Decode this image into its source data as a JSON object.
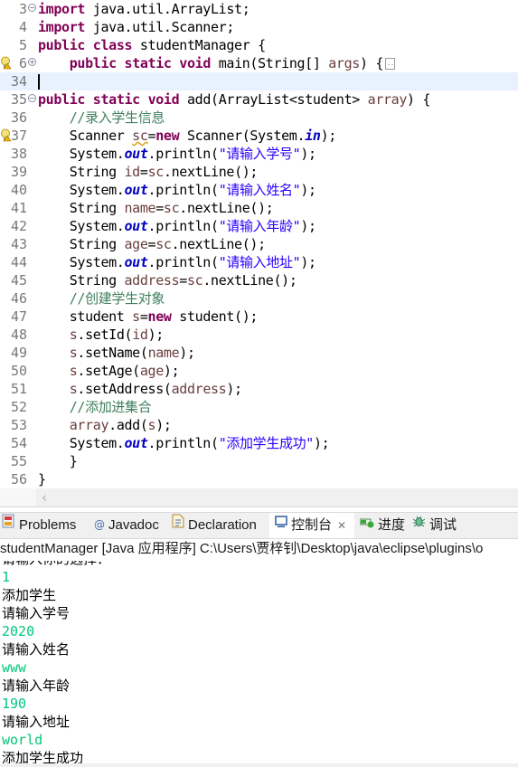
{
  "editor": {
    "lines": [
      {
        "no": "3",
        "fold": "collapse",
        "tokens": [
          {
            "t": "import",
            "c": "kw"
          },
          {
            "t": " java.util.ArrayList;"
          }
        ]
      },
      {
        "no": "4",
        "tokens": [
          {
            "t": "import",
            "c": "kw"
          },
          {
            "t": " java.util.Scanner;"
          }
        ]
      },
      {
        "no": "5",
        "tokens": [
          {
            "t": "public",
            "c": "kw"
          },
          {
            "t": " "
          },
          {
            "t": "class",
            "c": "kw"
          },
          {
            "t": " studentManager {"
          }
        ]
      },
      {
        "no": "6",
        "fold": "expand",
        "marker": "warning-lightbulb",
        "tokens": [
          {
            "t": "    "
          },
          {
            "t": "public",
            "c": "kw"
          },
          {
            "t": " "
          },
          {
            "t": "static",
            "c": "kw"
          },
          {
            "t": " "
          },
          {
            "t": "void",
            "c": "kw"
          },
          {
            "t": " main(String[] "
          },
          {
            "t": "args",
            "c": "var"
          },
          {
            "t": ") {"
          }
        ],
        "collapsed": true
      },
      {
        "no": "34",
        "current": true,
        "caret": true,
        "tokens": []
      },
      {
        "no": "35",
        "fold": "collapse",
        "tokens": [
          {
            "t": "public",
            "c": "kw"
          },
          {
            "t": " "
          },
          {
            "t": "static",
            "c": "kw"
          },
          {
            "t": " "
          },
          {
            "t": "void",
            "c": "kw"
          },
          {
            "t": " add(ArrayList<student> "
          },
          {
            "t": "array",
            "c": "var"
          },
          {
            "t": ") {"
          }
        ]
      },
      {
        "no": "36",
        "tokens": [
          {
            "t": "    "
          },
          {
            "t": "//录入学生信息",
            "c": "com"
          }
        ]
      },
      {
        "no": "37",
        "marker": "warning-lightbulb",
        "tokens": [
          {
            "t": "    Scanner "
          },
          {
            "t": "sc",
            "c": "var warn-ul"
          },
          {
            "t": "="
          },
          {
            "t": "new",
            "c": "kw"
          },
          {
            "t": " Scanner(System."
          },
          {
            "t": "in",
            "c": "fld"
          },
          {
            "t": ");"
          }
        ]
      },
      {
        "no": "38",
        "tokens": [
          {
            "t": "    System."
          },
          {
            "t": "out",
            "c": "fld"
          },
          {
            "t": ".println("
          },
          {
            "t": "\"请输入学号\"",
            "c": "str"
          },
          {
            "t": ");"
          }
        ]
      },
      {
        "no": "39",
        "tokens": [
          {
            "t": "    String "
          },
          {
            "t": "id",
            "c": "var"
          },
          {
            "t": "="
          },
          {
            "t": "sc",
            "c": "var"
          },
          {
            "t": ".nextLine();"
          }
        ]
      },
      {
        "no": "40",
        "tokens": [
          {
            "t": "    System."
          },
          {
            "t": "out",
            "c": "fld"
          },
          {
            "t": ".println("
          },
          {
            "t": "\"请输入姓名\"",
            "c": "str"
          },
          {
            "t": ");"
          }
        ]
      },
      {
        "no": "41",
        "tokens": [
          {
            "t": "    String "
          },
          {
            "t": "name",
            "c": "var"
          },
          {
            "t": "="
          },
          {
            "t": "sc",
            "c": "var"
          },
          {
            "t": ".nextLine();"
          }
        ]
      },
      {
        "no": "42",
        "tokens": [
          {
            "t": "    System."
          },
          {
            "t": "out",
            "c": "fld"
          },
          {
            "t": ".println("
          },
          {
            "t": "\"请输入年龄\"",
            "c": "str"
          },
          {
            "t": ");"
          }
        ]
      },
      {
        "no": "43",
        "tokens": [
          {
            "t": "    String "
          },
          {
            "t": "age",
            "c": "var"
          },
          {
            "t": "="
          },
          {
            "t": "sc",
            "c": "var"
          },
          {
            "t": ".nextLine();"
          }
        ]
      },
      {
        "no": "44",
        "tokens": [
          {
            "t": "    System."
          },
          {
            "t": "out",
            "c": "fld"
          },
          {
            "t": ".println("
          },
          {
            "t": "\"请输入地址\"",
            "c": "str"
          },
          {
            "t": ");"
          }
        ]
      },
      {
        "no": "45",
        "tokens": [
          {
            "t": "    String "
          },
          {
            "t": "address",
            "c": "var"
          },
          {
            "t": "="
          },
          {
            "t": "sc",
            "c": "var"
          },
          {
            "t": ".nextLine();"
          }
        ]
      },
      {
        "no": "46",
        "tokens": [
          {
            "t": "    "
          },
          {
            "t": "//创建学生对象",
            "c": "com"
          }
        ]
      },
      {
        "no": "47",
        "tokens": [
          {
            "t": "    student "
          },
          {
            "t": "s",
            "c": "var"
          },
          {
            "t": "="
          },
          {
            "t": "new",
            "c": "kw"
          },
          {
            "t": " student();"
          }
        ]
      },
      {
        "no": "48",
        "tokens": [
          {
            "t": "    "
          },
          {
            "t": "s",
            "c": "var"
          },
          {
            "t": ".setId("
          },
          {
            "t": "id",
            "c": "var"
          },
          {
            "t": ");"
          }
        ]
      },
      {
        "no": "49",
        "tokens": [
          {
            "t": "    "
          },
          {
            "t": "s",
            "c": "var"
          },
          {
            "t": ".setName("
          },
          {
            "t": "name",
            "c": "var"
          },
          {
            "t": ");"
          }
        ]
      },
      {
        "no": "50",
        "tokens": [
          {
            "t": "    "
          },
          {
            "t": "s",
            "c": "var"
          },
          {
            "t": ".setAge("
          },
          {
            "t": "age",
            "c": "var"
          },
          {
            "t": ");"
          }
        ]
      },
      {
        "no": "51",
        "tokens": [
          {
            "t": "    "
          },
          {
            "t": "s",
            "c": "var"
          },
          {
            "t": ".setAddress("
          },
          {
            "t": "address",
            "c": "var"
          },
          {
            "t": ");"
          }
        ]
      },
      {
        "no": "52",
        "tokens": [
          {
            "t": "    "
          },
          {
            "t": "//添加进集合",
            "c": "com"
          }
        ]
      },
      {
        "no": "53",
        "tokens": [
          {
            "t": "    "
          },
          {
            "t": "array",
            "c": "var"
          },
          {
            "t": ".add("
          },
          {
            "t": "s",
            "c": "var"
          },
          {
            "t": ");"
          }
        ]
      },
      {
        "no": "54",
        "tokens": [
          {
            "t": "    System."
          },
          {
            "t": "out",
            "c": "fld"
          },
          {
            "t": ".println("
          },
          {
            "t": "\"添加学生成功\"",
            "c": "str"
          },
          {
            "t": ");"
          }
        ]
      },
      {
        "no": "55",
        "tokens": [
          {
            "t": "    }"
          }
        ]
      },
      {
        "no": "56",
        "tokens": [
          {
            "t": "}"
          }
        ]
      }
    ],
    "hscroll_arrow": "‹"
  },
  "views": {
    "tabs": [
      {
        "label": "Problems",
        "icon": "problems-icon",
        "active": false
      },
      {
        "label": "Javadoc",
        "icon": "javadoc-icon",
        "active": false
      },
      {
        "label": "Declaration",
        "icon": "declaration-icon",
        "active": false
      },
      {
        "label": "控制台",
        "icon": "console-icon",
        "active": true,
        "close": "✕"
      },
      {
        "label": "进度",
        "icon": "progress-icon",
        "active": false
      },
      {
        "label": "调试",
        "icon": "debug-icon",
        "active": false
      }
    ]
  },
  "console": {
    "title": "studentManager [Java 应用程序] C:\\Users\\贾梓钊\\Desktop\\java\\eclipse\\plugins\\o",
    "clipped_line": "请输入你的选择：",
    "lines": [
      {
        "text": "1",
        "kind": "in"
      },
      {
        "text": "添加学生",
        "kind": "out"
      },
      {
        "text": "请输入学号",
        "kind": "out"
      },
      {
        "text": "2020",
        "kind": "in"
      },
      {
        "text": "请输入姓名",
        "kind": "out"
      },
      {
        "text": "www",
        "kind": "in"
      },
      {
        "text": "请输入年龄",
        "kind": "out"
      },
      {
        "text": "190",
        "kind": "in"
      },
      {
        "text": "请输入地址",
        "kind": "out"
      },
      {
        "text": "world",
        "kind": "in"
      },
      {
        "text": "添加学生成功",
        "kind": "out"
      }
    ]
  }
}
